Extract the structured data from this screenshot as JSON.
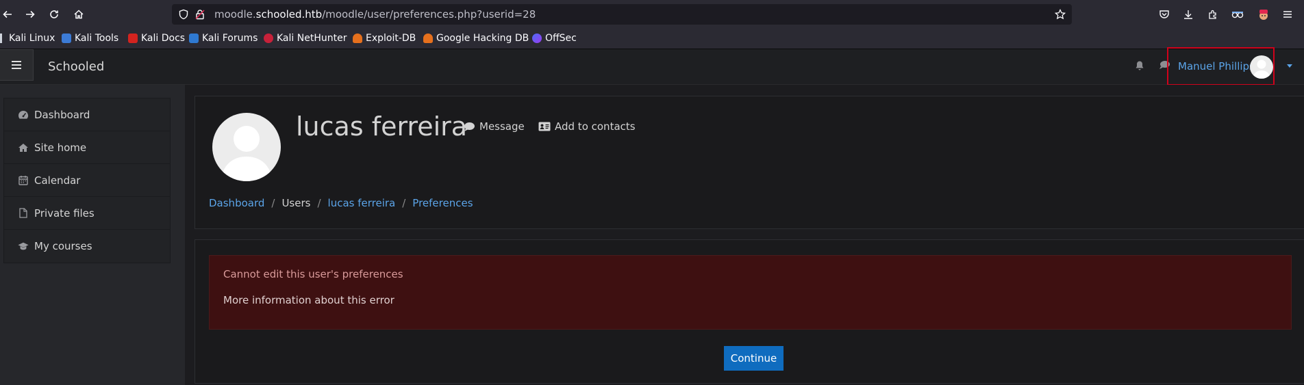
{
  "browser": {
    "url_prefix": "moodle.",
    "url_domain": "schooled.htb",
    "url_path": "/moodle/user/preferences.php?userid=28",
    "bookmarks": [
      "Kali Linux",
      "Kali Tools",
      "Kali Docs",
      "Kali Forums",
      "Kali NetHunter",
      "Exploit-DB",
      "Google Hacking DB",
      "OffSec"
    ],
    "icons": [
      "back-icon",
      "forward-icon",
      "reload-icon",
      "home-icon",
      "shield-icon",
      "lock-icon",
      "star-icon",
      "pocket-icon",
      "download-icon",
      "extensions-icon",
      "account-icon",
      "profile-icon",
      "menu-icon"
    ]
  },
  "navbar": {
    "brand": "Schooled",
    "user_name": "Manuel Phillips"
  },
  "sidebar": {
    "items": [
      {
        "label": "Dashboard",
        "icon": "dashboard-icon"
      },
      {
        "label": "Site home",
        "icon": "home-icon"
      },
      {
        "label": "Calendar",
        "icon": "calendar-icon"
      },
      {
        "label": "Private files",
        "icon": "file-icon"
      },
      {
        "label": "My courses",
        "icon": "graduation-cap-icon"
      }
    ]
  },
  "profile": {
    "name": "lucas ferreira",
    "message_label": "Message",
    "add_contact_label": "Add to contacts"
  },
  "breadcrumb": {
    "items": [
      "Dashboard",
      "Users",
      "lucas ferreira",
      "Preferences"
    ]
  },
  "error": {
    "message": "Cannot edit this user's preferences",
    "more_info": "More information about this error",
    "continue_label": "Continue"
  },
  "colors": {
    "link": "#5ba4e8",
    "error_bg": "#3e1011",
    "button": "#0f6cbf",
    "highlight_box": "#d0021b"
  }
}
